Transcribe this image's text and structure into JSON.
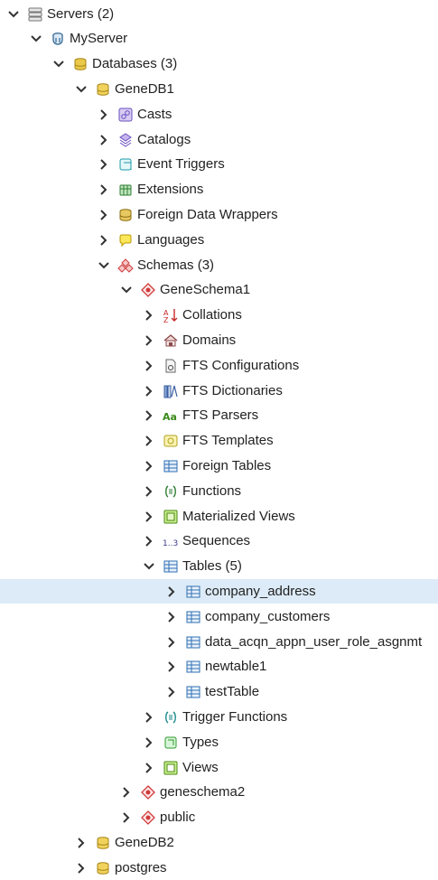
{
  "nodes": [
    {
      "label": "Servers (2)",
      "icon": "servers-icon",
      "expanded": true,
      "level": 0
    },
    {
      "label": "MyServer",
      "icon": "postgres-server-icon",
      "expanded": true,
      "level": 1
    },
    {
      "label": "Databases (3)",
      "icon": "databases-icon",
      "expanded": true,
      "level": 2
    },
    {
      "label": "GeneDB1",
      "icon": "database-icon",
      "expanded": true,
      "level": 3
    },
    {
      "label": "Casts",
      "icon": "casts-icon",
      "expanded": false,
      "level": 4
    },
    {
      "label": "Catalogs",
      "icon": "catalogs-icon",
      "expanded": false,
      "level": 4
    },
    {
      "label": "Event Triggers",
      "icon": "event-triggers-icon",
      "expanded": false,
      "level": 4
    },
    {
      "label": "Extensions",
      "icon": "extensions-icon",
      "expanded": false,
      "level": 4
    },
    {
      "label": "Foreign Data Wrappers",
      "icon": "foreign-data-wrappers-icon",
      "expanded": false,
      "level": 4
    },
    {
      "label": "Languages",
      "icon": "languages-icon",
      "expanded": false,
      "level": 4
    },
    {
      "label": "Schemas (3)",
      "icon": "schemas-icon",
      "expanded": true,
      "level": 4
    },
    {
      "label": "GeneSchema1",
      "icon": "schema-icon",
      "expanded": true,
      "level": 5
    },
    {
      "label": "Collations",
      "icon": "collations-icon",
      "expanded": false,
      "level": 6
    },
    {
      "label": "Domains",
      "icon": "domains-icon",
      "expanded": false,
      "level": 6
    },
    {
      "label": "FTS Configurations",
      "icon": "fts-configurations-icon",
      "expanded": false,
      "level": 6
    },
    {
      "label": "FTS Dictionaries",
      "icon": "fts-dictionaries-icon",
      "expanded": false,
      "level": 6
    },
    {
      "label": "FTS Parsers",
      "icon": "fts-parsers-icon",
      "expanded": false,
      "level": 6
    },
    {
      "label": "FTS Templates",
      "icon": "fts-templates-icon",
      "expanded": false,
      "level": 6
    },
    {
      "label": "Foreign Tables",
      "icon": "foreign-tables-icon",
      "expanded": false,
      "level": 6
    },
    {
      "label": "Functions",
      "icon": "functions-icon",
      "expanded": false,
      "level": 6
    },
    {
      "label": "Materialized Views",
      "icon": "materialized-views-icon",
      "expanded": false,
      "level": 6
    },
    {
      "label": "Sequences",
      "icon": "sequences-icon",
      "expanded": false,
      "level": 6
    },
    {
      "label": "Tables (5)",
      "icon": "tables-icon",
      "expanded": true,
      "level": 6
    },
    {
      "label": "company_address",
      "icon": "table-icon",
      "expanded": false,
      "level": 7,
      "selected": true
    },
    {
      "label": "company_customers",
      "icon": "table-icon",
      "expanded": false,
      "level": 7
    },
    {
      "label": "data_acqn_appn_user_role_asgnmt",
      "icon": "table-icon",
      "expanded": false,
      "level": 7
    },
    {
      "label": "newtable1",
      "icon": "table-icon",
      "expanded": false,
      "level": 7
    },
    {
      "label": "testTable",
      "icon": "table-icon",
      "expanded": false,
      "level": 7
    },
    {
      "label": "Trigger Functions",
      "icon": "trigger-functions-icon",
      "expanded": false,
      "level": 6
    },
    {
      "label": "Types",
      "icon": "types-icon",
      "expanded": false,
      "level": 6
    },
    {
      "label": "Views",
      "icon": "views-icon",
      "expanded": false,
      "level": 6
    },
    {
      "label": "geneschema2",
      "icon": "schema-icon",
      "expanded": false,
      "level": 5
    },
    {
      "label": "public",
      "icon": "schema-icon",
      "expanded": false,
      "level": 5
    },
    {
      "label": "GeneDB2",
      "icon": "database-icon",
      "expanded": false,
      "level": 3
    },
    {
      "label": "postgres",
      "icon": "database-icon",
      "expanded": false,
      "level": 3
    }
  ]
}
